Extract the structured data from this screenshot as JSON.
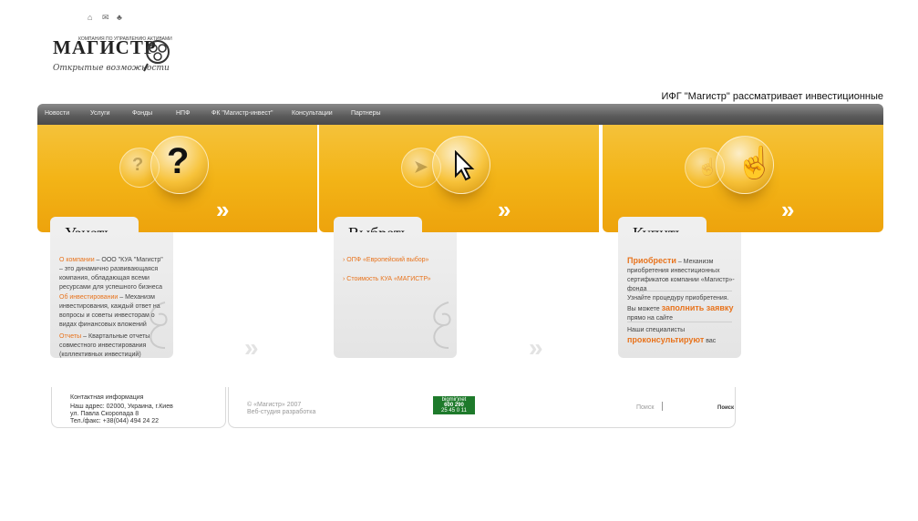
{
  "top_icons": {
    "home": "⌂",
    "mail": "✉",
    "print": "♣"
  },
  "logo": {
    "word": "МАГИСТР",
    "small": "КОМПАНИЯ ПО УПРАВЛЕНИЮ АКТИВАМИ",
    "slogan": "Открытые возможности"
  },
  "ticker": "ИФГ \"Магистр\" рассматривает инвестиционные",
  "nav": [
    "Новости",
    "Услуги",
    "Фонды",
    "НПФ",
    "ФК \"Магистр-инвест\"",
    "Консультации",
    "Партнеры"
  ],
  "cards": {
    "learn": {
      "title": "Узнать",
      "items": [
        {
          "link": "О компании",
          "text": " – ООО \"КУА \"Магистр\" – это динамично развивающаяся компания, обладающая всеми ресурсами для успешного бизнеса"
        },
        {
          "link": "Об инвестировании",
          "text": " – Механизм инвестирования, каждый ответ на вопросы и советы инвесторам о видах финансовых вложений"
        },
        {
          "link": "Отчеты",
          "text": " – Квартальные отчеты совместного инвестирования (коллективных инвестиций)"
        }
      ]
    },
    "choose": {
      "title": "Выбрать",
      "items": [
        "ОПФ «Европейский выбор»",
        "Стоимость КУА «МАГИСТР»"
      ]
    },
    "buy": {
      "title": "Купить",
      "p1_link": "Приобрести",
      "p1_text": " – Механизм приобретения инвестиционных сертификатов компании «Магистр»-фонда",
      "p2_pre": "Узнайте процедуру приобретения. Вы можете ",
      "p2_link": "заполнить заявку",
      "p2_post": " прямо на сайте",
      "p3_pre": "Наши специалисты ",
      "p3_link": "проконсультируют",
      "p3_post": " вас"
    }
  },
  "footer": {
    "contacts_title": "Контактная информация",
    "address1": "Наш адрес: 02000, Украина, г.Киев",
    "address2": "ул. Павла Скоропада 8",
    "phone": "Тел./факс: +38(044) 494 24 22",
    "copyright": "© «Магистр» 2007",
    "dev": "Веб-студия разработка",
    "counter_title": "bigmir)net",
    "counter_nums": "600 290",
    "counter_sub": "25 45    0 11",
    "search_label": "Поиск",
    "search_button": "Поиск"
  },
  "colors": {
    "accent": "#e8731c",
    "banner": "#f3b417",
    "nav": "#5a5a5a"
  }
}
